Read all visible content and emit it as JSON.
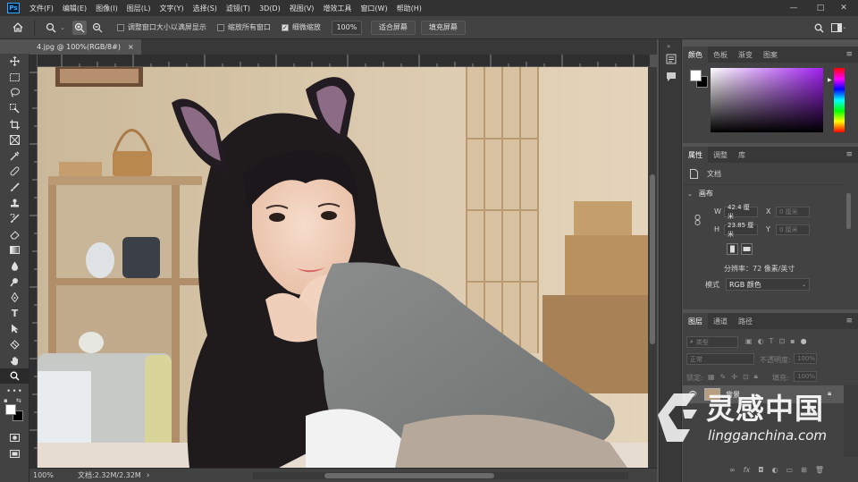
{
  "menu": {
    "logo": "Ps",
    "items": [
      "文件(F)",
      "编辑(E)",
      "图像(I)",
      "图层(L)",
      "文字(Y)",
      "选择(S)",
      "滤镜(T)",
      "3D(D)",
      "视图(V)",
      "增效工具",
      "窗口(W)",
      "帮助(H)"
    ],
    "window_controls": [
      "—",
      "□",
      "✕"
    ]
  },
  "options": {
    "resize_windows_label": "调整窗口大小以满屏显示",
    "resize_windows_checked": false,
    "zoom_all_label": "缩放所有窗口",
    "zoom_all_checked": false,
    "scrubby_label": "细微缩放",
    "scrubby_checked": true,
    "zoom_value": "100%",
    "fit_screen": "适合屏幕",
    "fill_screen": "填充屏幕"
  },
  "document": {
    "tab_title": "4.jpg @ 100%(RGB/8#)",
    "close": "×",
    "zoom": "100%",
    "doc_size": "文档:2.32M/2.32M",
    "status_arrow": "›"
  },
  "color_panel": {
    "tabs": [
      "颜色",
      "色板",
      "渐变",
      "图案"
    ],
    "active_tab": 0,
    "foreground": "#ffffff",
    "background": "#000000",
    "hue_color": "#a020f0"
  },
  "properties_panel": {
    "tabs": [
      "属性",
      "调整",
      "库"
    ],
    "active_tab": 0,
    "doc_label": "文档",
    "section": "画布",
    "w_label": "W",
    "w_value": "42.4 厘米",
    "h_label": "H",
    "h_value": "23.85 厘米",
    "x_label": "X",
    "x_value": "0 厘米",
    "y_label": "Y",
    "y_value": "0 厘米",
    "resolution": "分辨率：72 像素/英寸",
    "mode_label": "模式",
    "mode_value": "RGB 颜色"
  },
  "layers_panel": {
    "tabs": [
      "图层",
      "通道",
      "路径"
    ],
    "active_tab": 0,
    "filter_label": "类型",
    "blend_mode": "正常",
    "opacity_label": "不透明度:",
    "opacity_value": "100%",
    "lock_label": "锁定:",
    "fill_label": "填充:",
    "fill_value": "100%",
    "layer_name": "背景"
  },
  "watermark": {
    "title": "灵感中国",
    "url": "lingganchina.com"
  }
}
